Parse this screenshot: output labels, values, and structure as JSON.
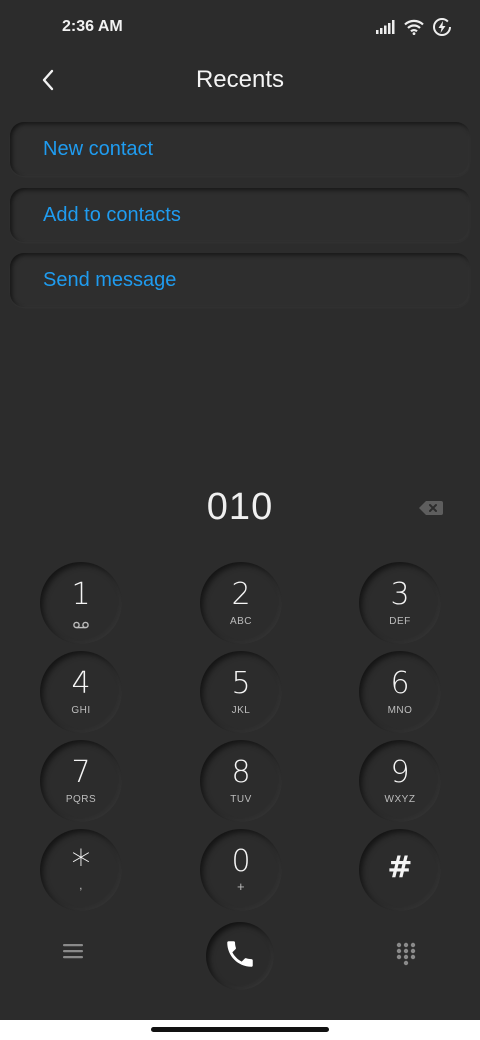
{
  "status_bar": {
    "time": "2:36 AM",
    "icons": [
      "signal-icon",
      "wifi-icon",
      "battery-charging-icon"
    ]
  },
  "header": {
    "title": "Recents",
    "back_icon": "chevron-left-icon"
  },
  "actions": [
    {
      "label": "New contact"
    },
    {
      "label": "Add to contacts"
    },
    {
      "label": "Send message"
    }
  ],
  "dialer": {
    "number": "010",
    "backspace_icon": "backspace-icon"
  },
  "keypad": [
    {
      "digit": "1",
      "letters": ""
    },
    {
      "digit": "2",
      "letters": "ABC"
    },
    {
      "digit": "3",
      "letters": "DEF"
    },
    {
      "digit": "4",
      "letters": "GHI"
    },
    {
      "digit": "5",
      "letters": "JKL"
    },
    {
      "digit": "6",
      "letters": "MNO"
    },
    {
      "digit": "7",
      "letters": "PQRS"
    },
    {
      "digit": "8",
      "letters": "TUV"
    },
    {
      "digit": "9",
      "letters": "WXYZ"
    },
    {
      "digit": "*",
      "letters": ","
    },
    {
      "digit": "0",
      "letters": "+"
    },
    {
      "digit": "#",
      "letters": ""
    }
  ],
  "bottom_bar": {
    "menu_icon": "hamburger-menu-icon",
    "call_icon": "phone-icon",
    "dialpad_icon": "dialpad-icon"
  },
  "colors": {
    "background": "#2c2c2c",
    "accent": "#1f9cf0",
    "text": "#f5f5f5"
  }
}
